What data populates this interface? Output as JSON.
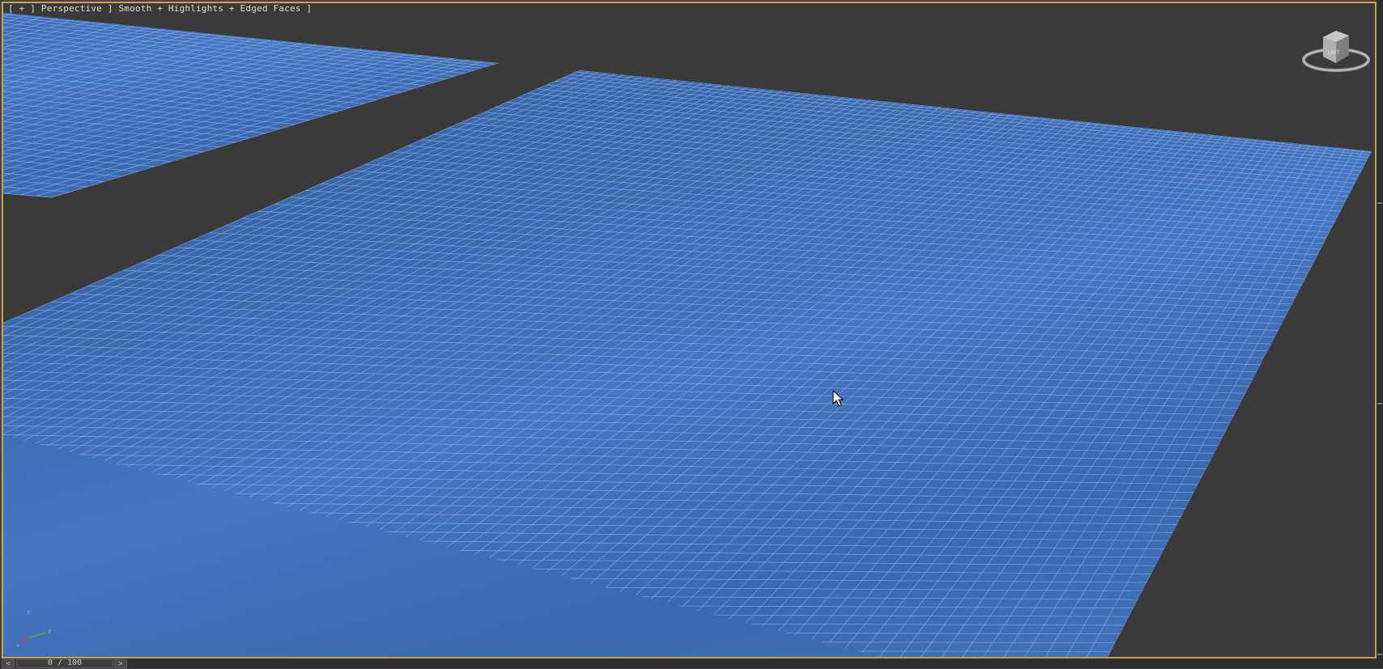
{
  "viewport": {
    "label": "[ + ] Perspective ] Smooth + Highlights + Edged Faces ]"
  },
  "viewcube": {
    "icon": "viewcube-icon"
  },
  "axis_tripod": {
    "x_label": "x",
    "y_label": "y",
    "z_label": "z"
  },
  "timeline": {
    "prev_label": "<",
    "next_label": ">",
    "slider_label": "0 / 100"
  },
  "colors": {
    "viewport_bg": "#3a3a3a",
    "plane_fill": "#4677c2",
    "plane_wire": "#8fb4ee",
    "active_border": "#c8a24a"
  }
}
